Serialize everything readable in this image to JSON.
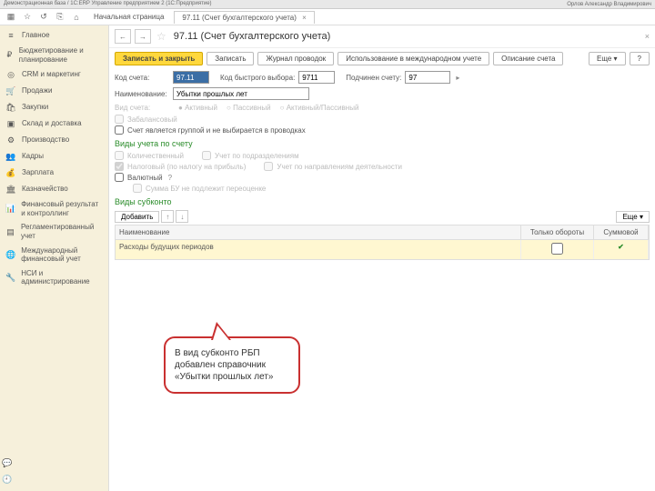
{
  "titlebar": {
    "left": "Демонстрационная база / 1С:ERP Управление предприятием 2 (1С:Предприятие)",
    "user": "Орлов Александр Владимирович"
  },
  "tabs": {
    "home": "Начальная страница",
    "active": "97.11 (Счет бухгалтерского учета)"
  },
  "header": {
    "title": "97.11 (Счет бухгалтерского учета)"
  },
  "buttons": {
    "save_close": "Записать и закрыть",
    "save": "Записать",
    "journal": "Журнал проводок",
    "intl": "Использование в международном учете",
    "desc": "Описание счета",
    "more": "Еще",
    "help": "?"
  },
  "form": {
    "code_label": "Код счета:",
    "code_value": "97.11",
    "fast_label": "Код быстрого выбора:",
    "fast_value": "9711",
    "parent_label": "Подчинен счету:",
    "parent_value": "97",
    "name_label": "Наименование:",
    "name_value": "Убытки прошлых лет",
    "type_label": "Вид счета:",
    "type_active": "Активный",
    "type_passive": "Пассивный",
    "type_ap": "Активный/Пассивный",
    "cb_offbalance": "Забалансовый",
    "cb_group": "Счет является группой и не выбирается в проводках"
  },
  "sections": {
    "acct_types": "Виды учета по счету",
    "cb_qty": "Количественный",
    "cb_dept": "Учет по подразделениям",
    "cb_tax": "Налоговый (по налогу на прибыль)",
    "cb_dir": "Учет по направлениям деятельности",
    "cb_cur": "Валютный",
    "cb_bu": "Сумма БУ не подлежит переоценке",
    "subkonto": "Виды субконто",
    "add": "Добавить",
    "more2": "Еще"
  },
  "table": {
    "col_name": "Наименование",
    "col_ob": "Только обороты",
    "col_sum": "Суммовой",
    "row1_name": "Расходы будущих периодов",
    "row1_sum": "✔"
  },
  "sidebar": [
    "Главное",
    "Бюджетирование и планирование",
    "CRM и маркетинг",
    "Продажи",
    "Закупки",
    "Склад и доставка",
    "Производство",
    "Кадры",
    "Зарплата",
    "Казначейство",
    "Финансовый результат и контроллинг",
    "Регламентированный учет",
    "Международный финансовый учет",
    "НСИ и администрирование"
  ],
  "callout": "В вид субконто РБП добавлен справочник «Убытки прошлых лет»"
}
